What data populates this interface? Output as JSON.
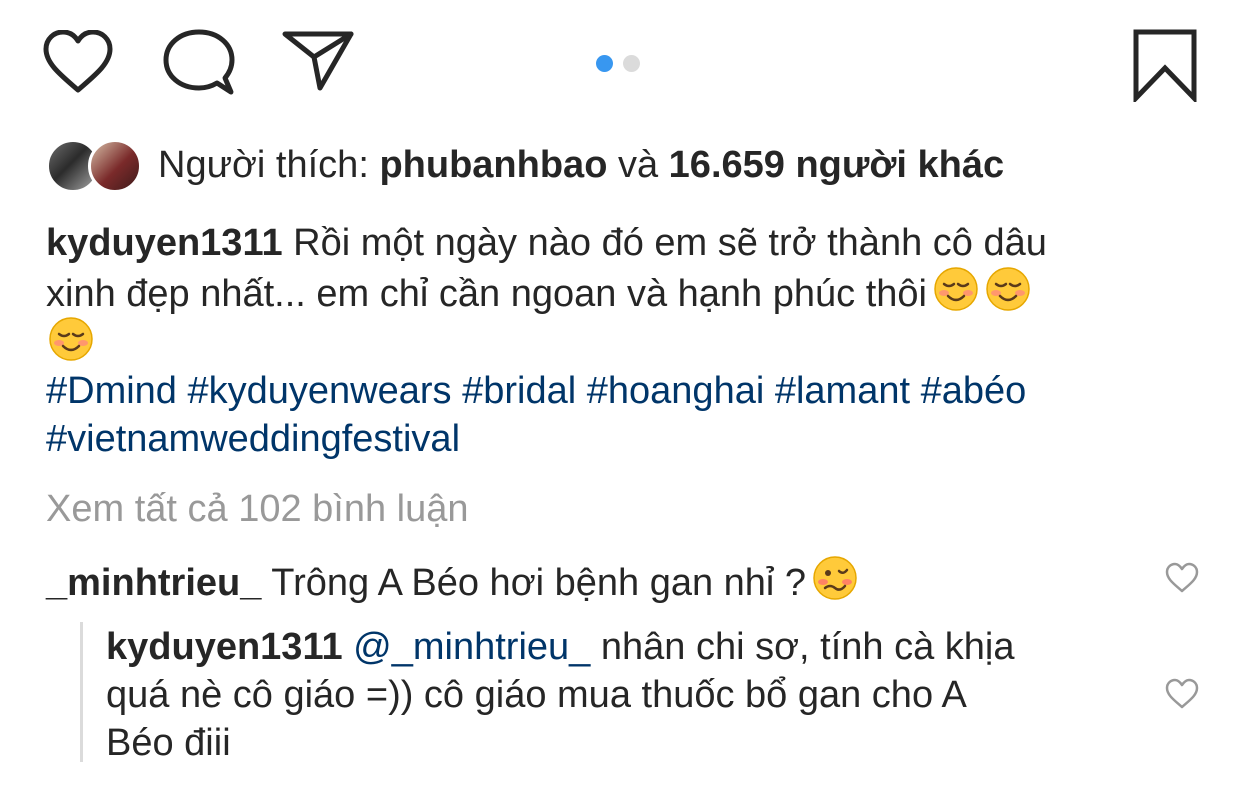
{
  "actions": {
    "like_icon": "heart-outline",
    "comment_icon": "speech-bubble",
    "share_icon": "paper-plane",
    "save_icon": "bookmark",
    "carousel": {
      "total": 2,
      "active": 1
    }
  },
  "likes": {
    "prefix": "Người thích:",
    "user": "phubanhbao",
    "conj": "và",
    "others": "16.659 người khác"
  },
  "caption": {
    "user": "kyduyen1311",
    "line1": "Rồi một ngày nào đó em sẽ trở thành cô dâu",
    "line2": "xinh đẹp nhất... em chỉ cần ngoan và hạnh phúc thôi",
    "emoji": "smiling-face-emoji"
  },
  "hashtags": {
    "line1": [
      "#Dmind",
      "#kyduyenwears",
      "#bridal",
      "#hoanghai",
      "#lamant",
      "#abéo"
    ],
    "line2": [
      "#vietnamweddingfestival"
    ]
  },
  "view_all": "Xem tất cả 102 bình luận",
  "comments": [
    {
      "user": "_minhtrieu_",
      "text": "Trông A Béo hơi bệnh gan nhỉ ?",
      "emoji": "woozy-face-emoji"
    }
  ],
  "reply": {
    "user": "kyduyen1311",
    "mention": "@_minhtrieu_",
    "line1": "nhân chi sơ, tính cà khịa",
    "line2": "quá nè cô giáo =)) cô giáo mua thuốc bổ gan cho A",
    "line3": "Béo điii"
  },
  "colors": {
    "text": "#262626",
    "hashtag": "#003569",
    "muted": "#999999",
    "carousel_active": "#3897f0",
    "carousel_inactive": "#dbdbdb"
  }
}
